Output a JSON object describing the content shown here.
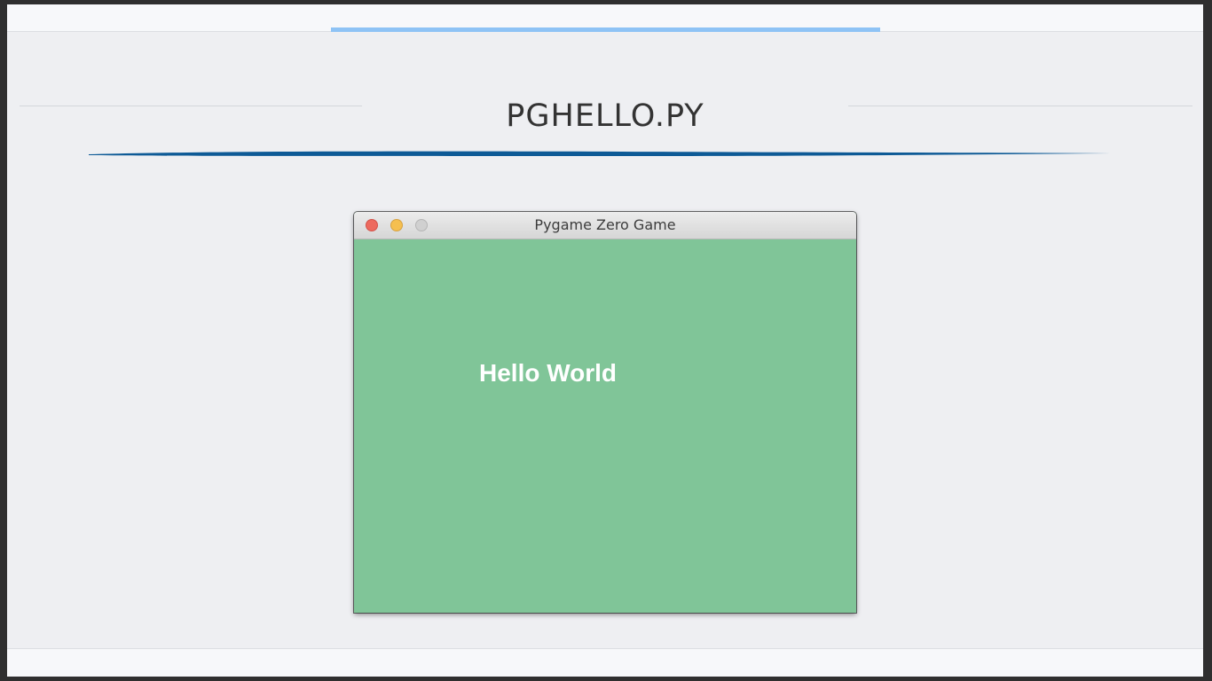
{
  "slide": {
    "title": "PGHELLO.PY"
  },
  "window": {
    "title": "Pygame Zero Game",
    "canvas_background": "#80c598",
    "canvas_text": "Hello World",
    "canvas_text_color": "#ffffff"
  },
  "colors": {
    "accent_top": "#8ec3f5",
    "brush_stroke": "#0d5a96"
  }
}
